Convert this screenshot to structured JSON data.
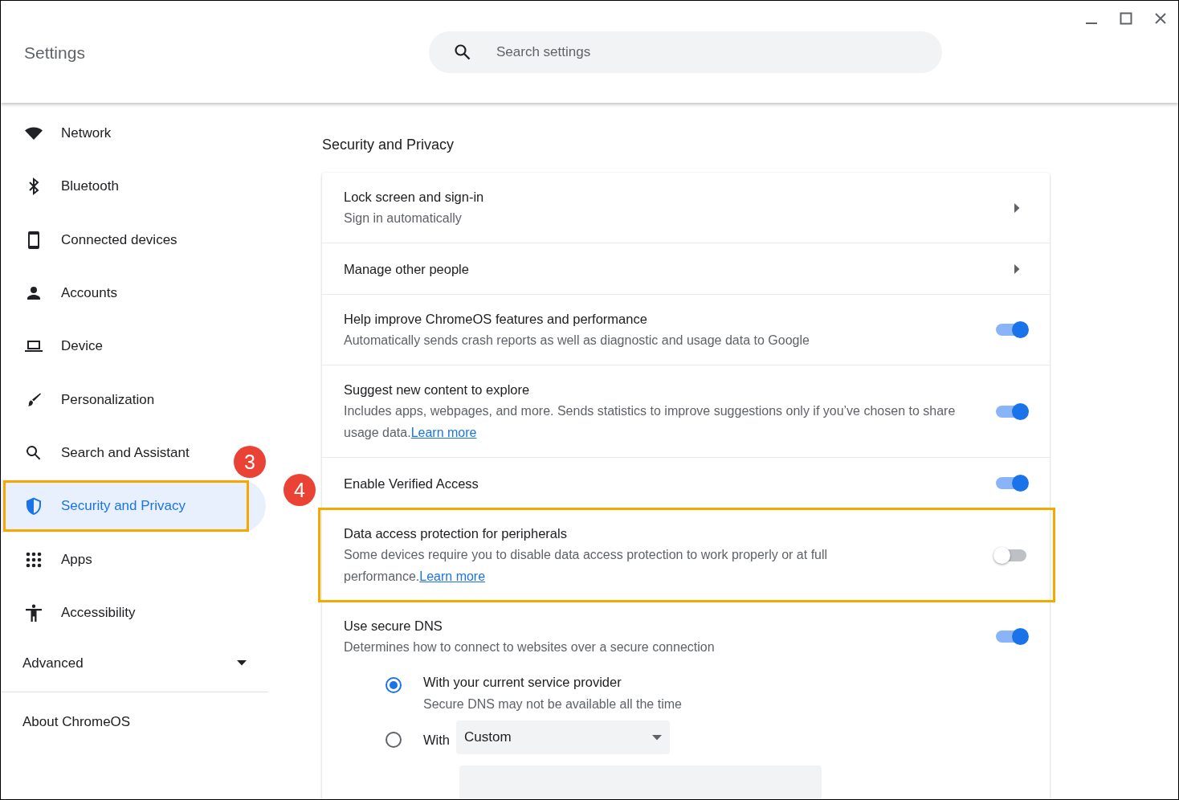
{
  "window": {
    "title": "Settings"
  },
  "search": {
    "placeholder": "Search settings"
  },
  "sidebar": {
    "items": [
      {
        "label": "Network",
        "kind": "wifi",
        "selected": false
      },
      {
        "label": "Bluetooth",
        "kind": "bluetooth",
        "selected": false
      },
      {
        "label": "Connected devices",
        "kind": "phone",
        "selected": false
      },
      {
        "label": "Accounts",
        "kind": "person",
        "selected": false
      },
      {
        "label": "Device",
        "kind": "laptop",
        "selected": false
      },
      {
        "label": "Personalization",
        "kind": "brush",
        "selected": false
      },
      {
        "label": "Search and Assistant",
        "kind": "search",
        "selected": false
      },
      {
        "label": "Security and Privacy",
        "kind": "shield",
        "selected": true,
        "highlighted": true,
        "badge": "3"
      },
      {
        "label": "Apps",
        "kind": "grid",
        "selected": false
      },
      {
        "label": "Accessibility",
        "kind": "accessibility",
        "selected": false
      }
    ],
    "advanced": {
      "label": "Advanced",
      "expanded": false
    },
    "about": "About ChromeOS"
  },
  "section": {
    "heading": "Security and Privacy",
    "rows": [
      {
        "kind": "link",
        "title": "Lock screen and sign-in",
        "description": "Sign in automatically"
      },
      {
        "kind": "link",
        "title": "Manage other people"
      },
      {
        "kind": "toggle",
        "title": "Help improve ChromeOS features and performance",
        "description": "Automatically sends crash reports as well as diagnostic and usage data to Google",
        "on": true
      },
      {
        "kind": "toggle",
        "title": "Suggest new content to explore",
        "description": "Includes apps, webpages, and more. Sends statistics to improve suggestions only if you’ve chosen to share usage data.",
        "link": "Learn more",
        "on": true
      },
      {
        "kind": "toggle",
        "title": "Enable Verified Access",
        "on": true
      },
      {
        "kind": "toggle",
        "title": "Data access protection for peripherals",
        "description": "Some devices require you to disable data access protection to work properly or at full performance.",
        "link": "Learn more",
        "on": false,
        "highlighted": true,
        "badge": "4"
      },
      {
        "kind": "dns",
        "title": "Use secure DNS",
        "description": "Determines how to connect to websites over a secure connection",
        "on": true,
        "options": [
          {
            "label": "With your current service provider",
            "description": "Secure DNS may not be available all the time",
            "selected": true
          },
          {
            "label": "With",
            "dropdown": "Custom",
            "selected": false
          }
        ]
      }
    ]
  }
}
